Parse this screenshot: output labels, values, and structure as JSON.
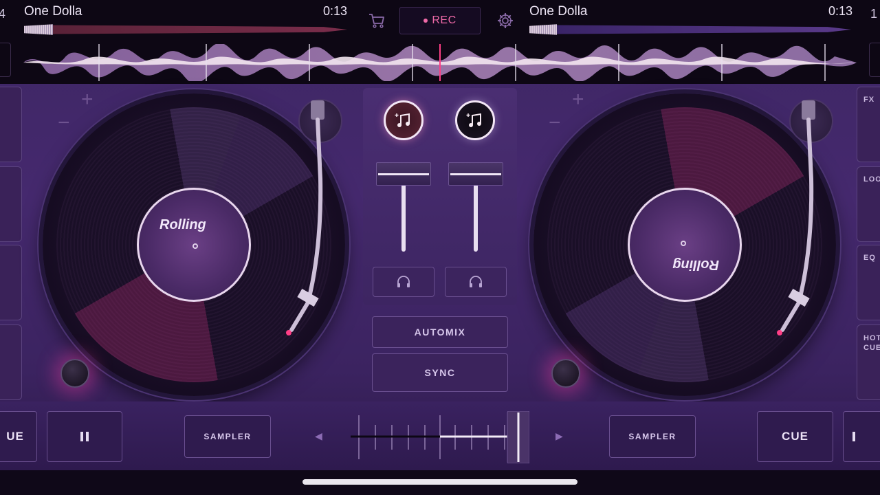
{
  "deck_left": {
    "number": "4",
    "title": "One Dolla",
    "time": "0:13",
    "label_text": "Rolling",
    "plus": "+",
    "minus": "−"
  },
  "deck_right": {
    "number": "1",
    "title": "One Dolla",
    "time": "0:13",
    "label_text": "Rolling",
    "plus": "+",
    "minus": "−"
  },
  "header": {
    "rec_label": "REC",
    "cart_icon": "cart-icon",
    "settings_icon": "gear-icon"
  },
  "side_tabs_right": [
    "FX",
    "LOO",
    "EQ",
    "HOT CUE"
  ],
  "mixer": {
    "automix_label": "AUTOMIX",
    "sync_label": "SYNC",
    "left_fader_level": 0.9,
    "right_fader_level": 0.9
  },
  "bottom": {
    "left_cue_label": "UE",
    "pause_icon": "pause-icon",
    "left_sampler_label": "SAMPLER",
    "right_sampler_label": "SAMPLER",
    "right_cue_label": "CUE",
    "crossfader_position": 0.95
  },
  "colors": {
    "accent_pink": "#ff3e86",
    "rec_pink": "#f06aa8",
    "panel_purple": "#3d2663"
  }
}
